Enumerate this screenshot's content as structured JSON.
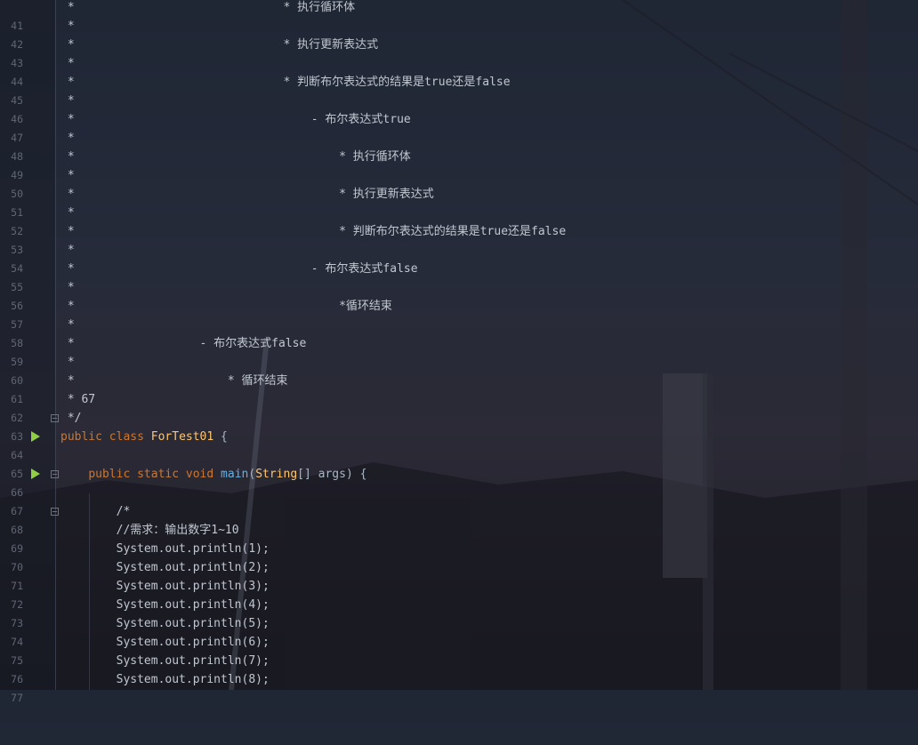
{
  "editor": {
    "lines": [
      {
        "num": "41",
        "text": " *                              * 执行循环体"
      },
      {
        "num": "42",
        "text": " *"
      },
      {
        "num": "43",
        "text": " *                              * 执行更新表达式"
      },
      {
        "num": "44",
        "text": " *"
      },
      {
        "num": "45",
        "text": " *                              * 判断布尔表达式的结果是true还是false"
      },
      {
        "num": "46",
        "text": " *"
      },
      {
        "num": "47",
        "text": " *                                  - 布尔表达式true"
      },
      {
        "num": "48",
        "text": " *"
      },
      {
        "num": "49",
        "text": " *                                      * 执行循环体"
      },
      {
        "num": "50",
        "text": " *"
      },
      {
        "num": "51",
        "text": " *                                      * 执行更新表达式"
      },
      {
        "num": "52",
        "text": " *"
      },
      {
        "num": "53",
        "text": " *                                      * 判断布尔表达式的结果是true还是false"
      },
      {
        "num": "54",
        "text": " *"
      },
      {
        "num": "55",
        "text": " *                                  - 布尔表达式false"
      },
      {
        "num": "56",
        "text": " *"
      },
      {
        "num": "57",
        "text": " *                                      *循环结束"
      },
      {
        "num": "58",
        "text": " *"
      },
      {
        "num": "59",
        "text": " *                  - 布尔表达式false"
      },
      {
        "num": "60",
        "text": " *"
      },
      {
        "num": "61",
        "text": " *                      * 循环结束"
      },
      {
        "num": "62",
        "text": " * 67"
      },
      {
        "num": "63",
        "text": " */"
      },
      {
        "num": "64",
        "kw1": "public",
        "kw2": "class",
        "cls": "ForTest01",
        "rest": " {"
      },
      {
        "num": "65",
        "text": ""
      },
      {
        "num": "66",
        "indent": "    ",
        "kw1": "public",
        "kw2": "static",
        "kw3": "void",
        "fn": "main",
        "p1": "(",
        "tp": "String",
        "p2": "[] args) {"
      },
      {
        "num": "67",
        "text": ""
      },
      {
        "num": "68",
        "text": "        /*"
      },
      {
        "num": "69",
        "text": "        //需求：输出数字1~10"
      },
      {
        "num": "70",
        "text": "        System.out.println(1);"
      },
      {
        "num": "71",
        "text": "        System.out.println(2);"
      },
      {
        "num": "72",
        "text": "        System.out.println(3);"
      },
      {
        "num": "73",
        "text": "        System.out.println(4);"
      },
      {
        "num": "74",
        "text": "        System.out.println(5);"
      },
      {
        "num": "75",
        "text": "        System.out.println(6);"
      },
      {
        "num": "76",
        "text": "        System.out.println(7);"
      },
      {
        "num": "77",
        "text": "        System.out.println(8);"
      }
    ]
  }
}
